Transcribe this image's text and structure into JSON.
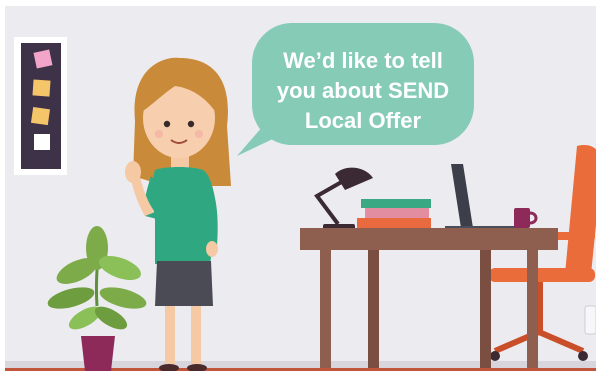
{
  "speech_bubble": {
    "lines": [
      "We’d like to tell",
      "you about SEND",
      "Local Offer"
    ]
  },
  "colors": {
    "wall": "#ecebef",
    "floor_line": "#c0553b",
    "bubble": "#85cbb6",
    "sweater": "#2fa882",
    "skirt": "#4a4b55",
    "hair": "#c98a3a",
    "desk": "#8e5e4e",
    "chair": "#ea6c3a",
    "pot": "#8e2a5a",
    "mug": "#8e2a5a",
    "lamp": "#3c2a33",
    "board": "#3e3248"
  }
}
